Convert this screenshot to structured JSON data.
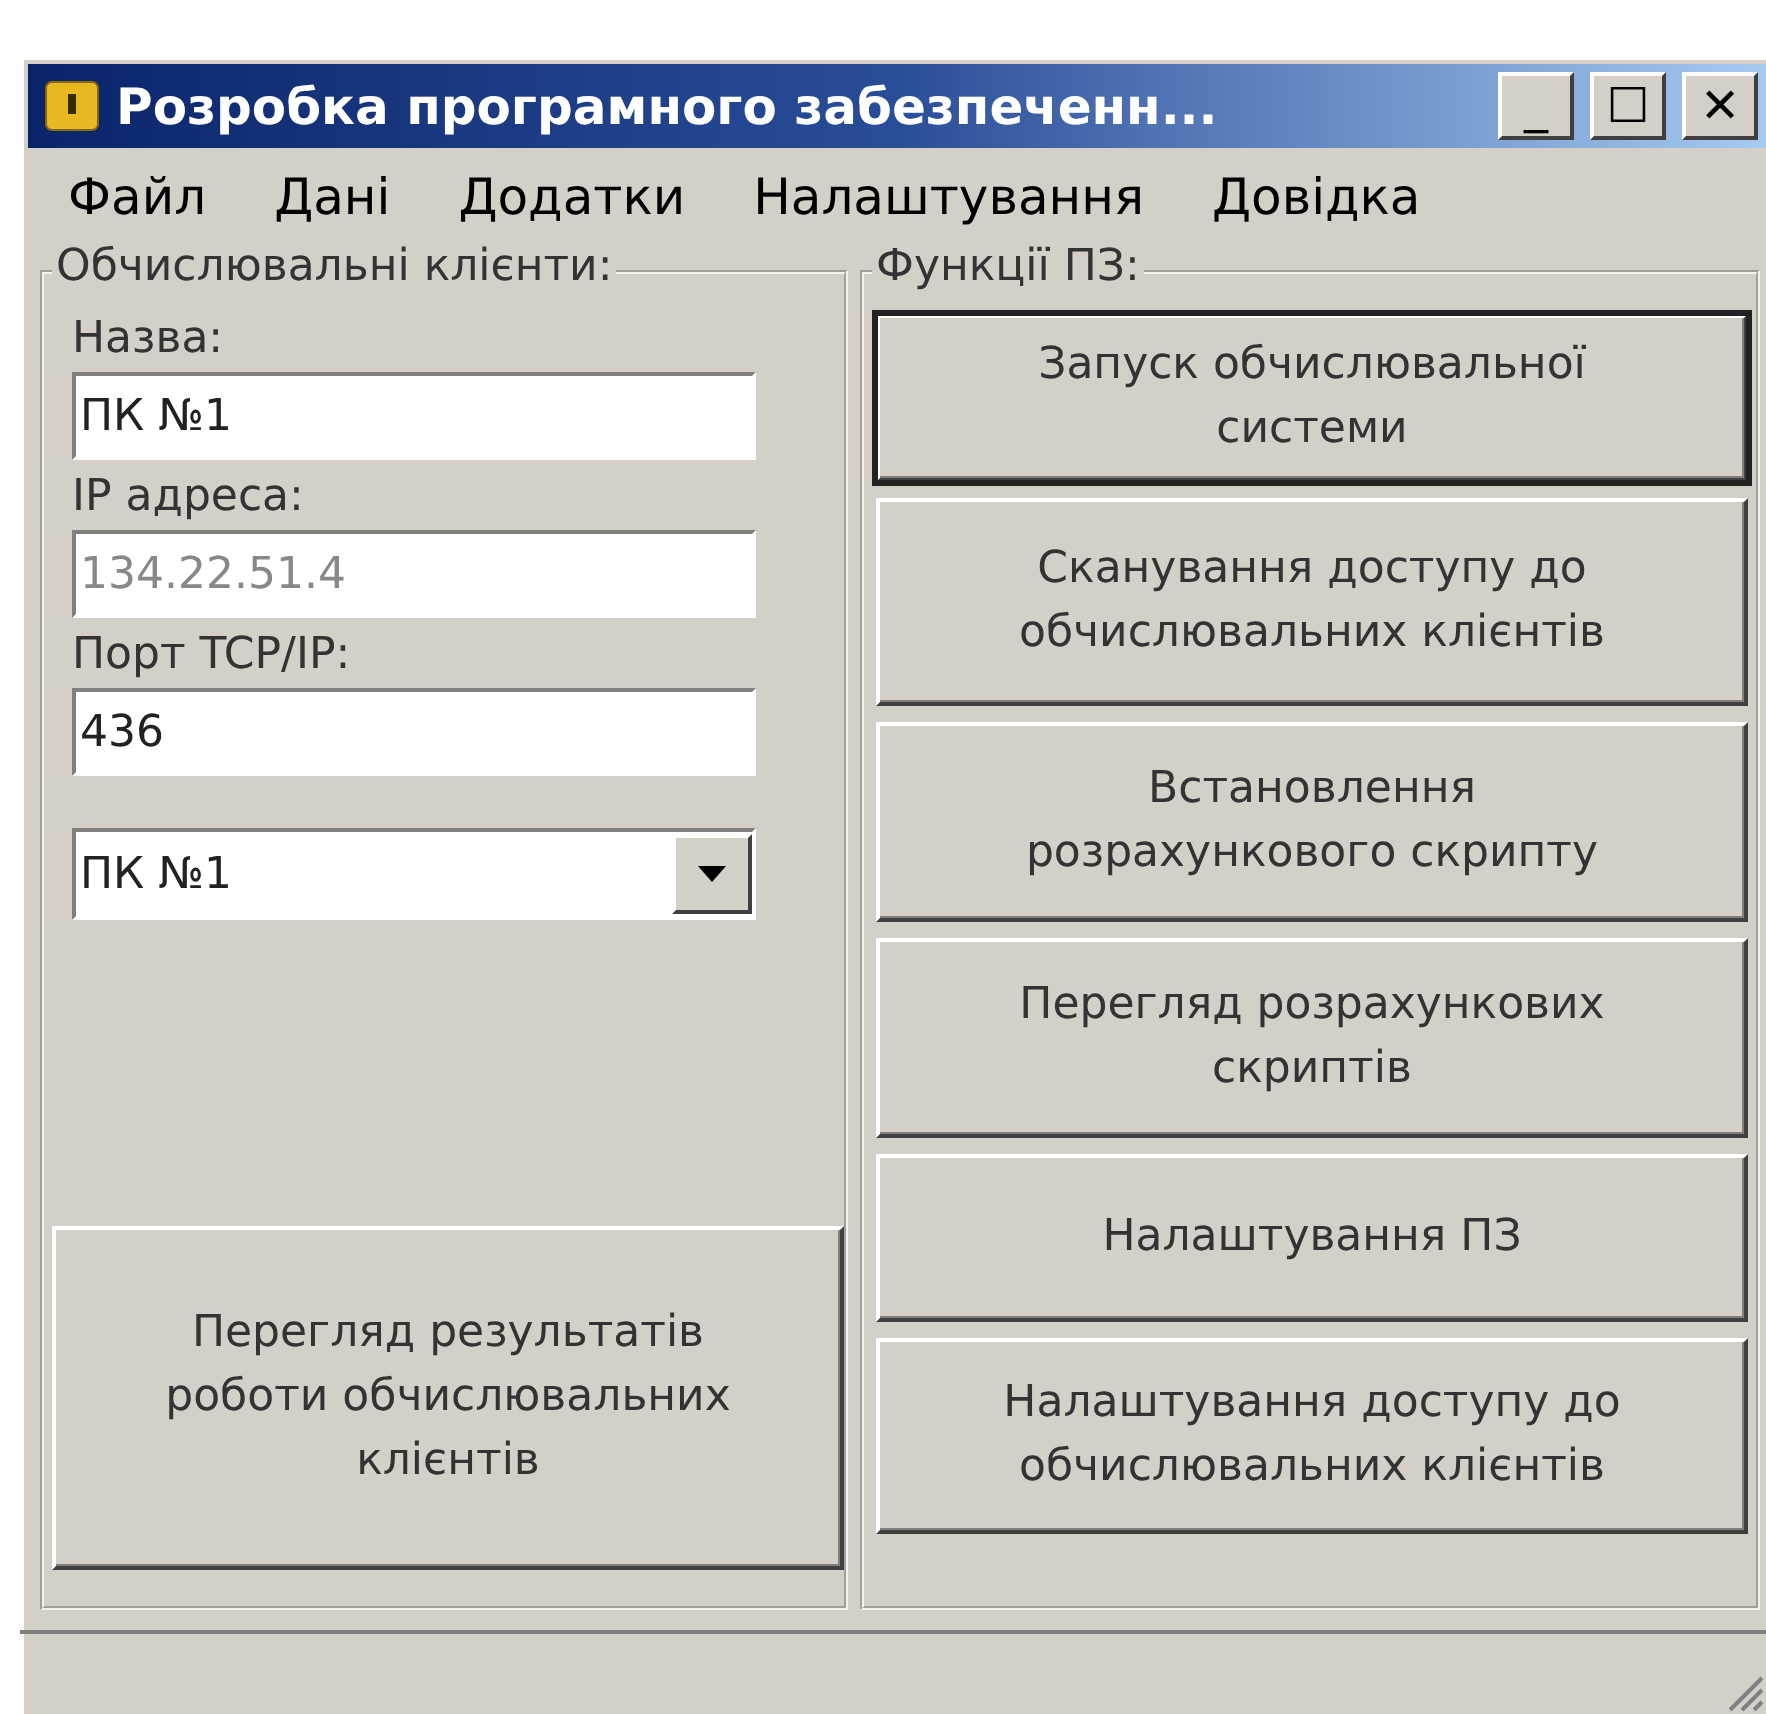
{
  "window": {
    "title": "Розробка програмного забезпеченн...",
    "controls": [
      "_",
      "☐",
      "✕"
    ]
  },
  "menu": [
    "Файл",
    "Дані",
    "Додатки",
    "Налаштування",
    "Довідка"
  ],
  "clients": {
    "title": "Обчислювальні клієнти:",
    "fields": [
      {
        "label": "Назва:",
        "value": "ПК №1",
        "disabled": false
      },
      {
        "label": "IP адреса:",
        "value": "134.22.51.4",
        "disabled": true
      },
      {
        "label": "Порт TCP/IP:",
        "value": "436",
        "disabled": false
      }
    ],
    "dropdown": {
      "value": "ПК №1"
    },
    "button": "Перегляд результатів роботи обчислювальних клієнтів"
  },
  "functions": {
    "title": "Функції ПЗ:",
    "buttons": [
      {
        "label": "Запуск обчислювальної системи",
        "default": true
      },
      {
        "label": "Сканування доступу до обчислювальних клієнтів",
        "default": false
      },
      {
        "label": "Встановлення розрахункового скрипту",
        "default": false
      },
      {
        "label": "Перегляд розрахункових скриптів",
        "default": false
      },
      {
        "label": "Налаштування ПЗ",
        "default": false
      },
      {
        "label": "Налаштування доступу до обчислювальних клієнтів",
        "default": false
      }
    ]
  }
}
